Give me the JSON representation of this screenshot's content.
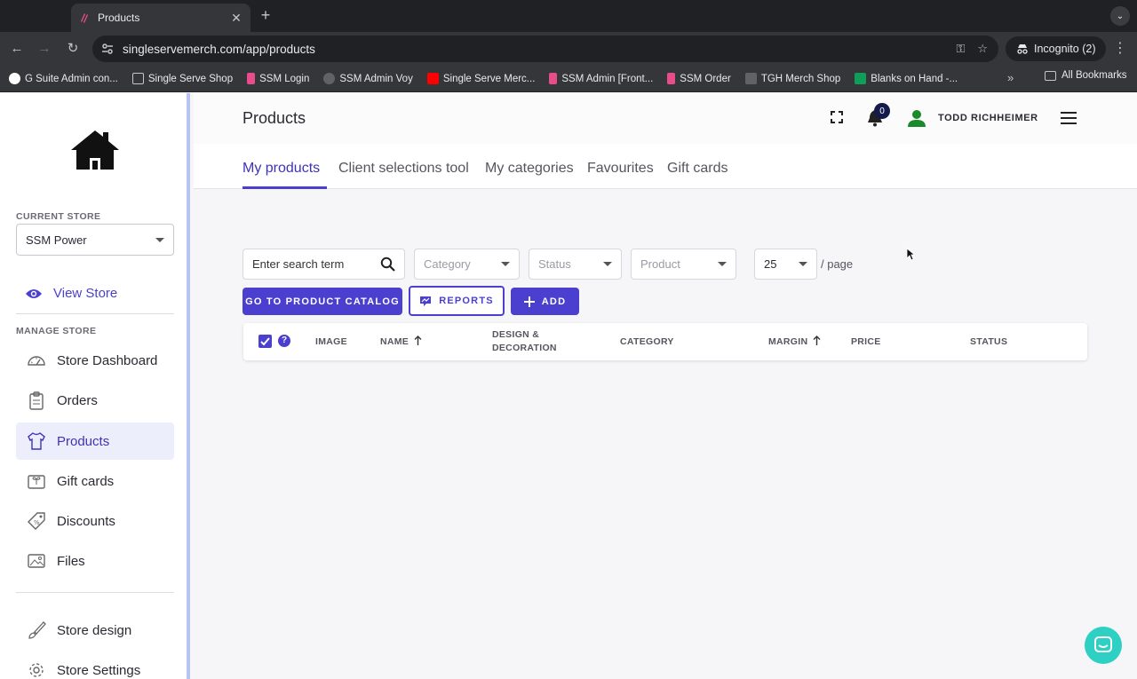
{
  "browser": {
    "tab_title": "Products",
    "url": "singleservemerch.com/app/products",
    "incognito_label": "Incognito (2)",
    "bookmarks": [
      {
        "label": "G Suite Admin con...",
        "icon": "google-icon",
        "color": "#ea4335"
      },
      {
        "label": "Single Serve Shop",
        "icon": "folder-icon",
        "color": "#c4c7c5"
      },
      {
        "label": "SSM Login",
        "icon": "ssm-icon",
        "color": "#e84c8b"
      },
      {
        "label": "SSM Admin Voy",
        "icon": "gear-icon",
        "color": "#9aa0a6"
      },
      {
        "label": "Single Serve Merc...",
        "icon": "youtube-icon",
        "color": "#ff0000"
      },
      {
        "label": "SSM Admin [Front...",
        "icon": "ssm-icon",
        "color": "#e84c8b"
      },
      {
        "label": "SSM Order",
        "icon": "ssm-icon",
        "color": "#e84c8b"
      },
      {
        "label": "TGH Merch Shop",
        "icon": "tgh-icon",
        "color": "#5f6368"
      },
      {
        "label": "Blanks on Hand -...",
        "icon": "sheets-icon",
        "color": "#0f9d58"
      }
    ],
    "all_bookmarks_label": "All Bookmarks"
  },
  "sidebar": {
    "current_store_label": "CURRENT STORE",
    "current_store_value": "SSM Power",
    "view_store_label": "View Store",
    "manage_store_label": "MANAGE STORE",
    "items": [
      {
        "label": "Store Dashboard",
        "icon": "dashboard-icon"
      },
      {
        "label": "Orders",
        "icon": "clipboard-icon"
      },
      {
        "label": "Products",
        "icon": "shirt-icon",
        "active": true
      },
      {
        "label": "Gift cards",
        "icon": "gift-card-icon"
      },
      {
        "label": "Discounts",
        "icon": "tag-icon"
      },
      {
        "label": "Files",
        "icon": "image-icon"
      }
    ],
    "bottom_items": [
      {
        "label": "Store design",
        "icon": "brush-icon"
      },
      {
        "label": "Store Settings",
        "icon": "gear-icon"
      }
    ]
  },
  "header": {
    "page_title": "Products",
    "notification_count": "0",
    "user_name": "TODD RICHHEIMER"
  },
  "tabs": [
    "My products",
    "Client selections tool",
    "My categories",
    "Favourites",
    "Gift cards"
  ],
  "filters": {
    "search_placeholder": "Enter search term",
    "category_placeholder": "Category",
    "status_placeholder": "Status",
    "product_placeholder": "Product",
    "page_size": "25",
    "per_page_label": "/ page"
  },
  "actions": {
    "catalog_label": "GO TO PRODUCT CATALOG",
    "reports_label": "REPORTS",
    "add_label": "ADD"
  },
  "table": {
    "help_symbol": "?",
    "columns": [
      "IMAGE",
      "NAME",
      "DESIGN &\nDECORATION",
      "CATEGORY",
      "MARGIN",
      "PRICE",
      "STATUS"
    ]
  },
  "colors": {
    "accent": "#4b3fcf",
    "sidebar_border": "#b7c3f2",
    "chat": "#2fd0c4"
  }
}
